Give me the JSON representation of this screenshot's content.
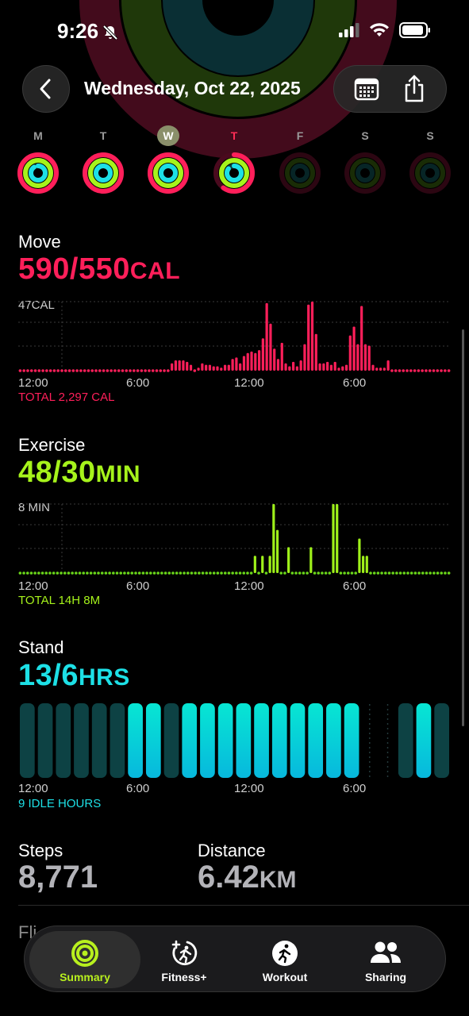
{
  "status_bar": {
    "time": "9:26"
  },
  "nav": {
    "title": "Wednesday, Oct 22, 2025"
  },
  "week": [
    {
      "letter": "M",
      "move": 1.0,
      "exercise": 1.0,
      "stand": 0.9,
      "state": "past"
    },
    {
      "letter": "T",
      "move": 1.0,
      "exercise": 1.0,
      "stand": 1.0,
      "state": "past"
    },
    {
      "letter": "W",
      "move": 1.0,
      "exercise": 1.0,
      "stand": 1.0,
      "state": "selected"
    },
    {
      "letter": "T",
      "move": 0.6,
      "exercise": 1.0,
      "stand": 0.85,
      "state": "today"
    },
    {
      "letter": "F",
      "move": 0,
      "exercise": 0,
      "stand": 0,
      "state": "future"
    },
    {
      "letter": "S",
      "move": 0,
      "exercise": 0,
      "stand": 0,
      "state": "future"
    },
    {
      "letter": "S",
      "move": 0,
      "exercise": 0,
      "stand": 0,
      "state": "future"
    }
  ],
  "move": {
    "title": "Move",
    "value": "590/550",
    "unit": "CAL",
    "scale_label": "47CAL",
    "total": "TOTAL 2,297 CAL",
    "ticks": [
      "12:00",
      "6:00",
      "12:00",
      "6:00"
    ],
    "color": "#ff1f5a"
  },
  "exercise": {
    "title": "Exercise",
    "value": "48/30",
    "unit": "MIN",
    "scale_label": "8 MIN",
    "total": "TOTAL 14H 8M",
    "ticks": [
      "12:00",
      "6:00",
      "12:00",
      "6:00"
    ],
    "color": "#a6f31b"
  },
  "stand": {
    "title": "Stand",
    "value": "13/6",
    "unit": "HRS",
    "total": "9 IDLE HOURS",
    "ticks": [
      "12:00",
      "6:00",
      "12:00",
      "6:00"
    ],
    "color": "#1de0e6"
  },
  "stats": {
    "steps_label": "Steps",
    "steps_value": "8,771",
    "distance_label": "Distance",
    "distance_value": "6.42",
    "distance_unit": "KM",
    "flights_label": "Fli"
  },
  "chart_data": [
    {
      "type": "bar",
      "title": "Move",
      "unit": "CAL",
      "x_label_ticks": [
        "12:00",
        "6:00",
        "12:00",
        "6:00"
      ],
      "ylim": [
        0,
        47
      ],
      "bins_per_hour": 4,
      "values": [
        1,
        1,
        1,
        1,
        1,
        1,
        1,
        1,
        1,
        1,
        1,
        1,
        1,
        1,
        1,
        1,
        1,
        1,
        1,
        1,
        1,
        1,
        1,
        1,
        1,
        1,
        1,
        1,
        1,
        1,
        1,
        1,
        1,
        1,
        1,
        1,
        1,
        1,
        1,
        1,
        5,
        7,
        7,
        7,
        6,
        4,
        1,
        2,
        5,
        4,
        4,
        3,
        3,
        2,
        4,
        4,
        8,
        9,
        5,
        10,
        12,
        13,
        12,
        14,
        22,
        46,
        32,
        15,
        8,
        19,
        5,
        3,
        6,
        3,
        7,
        18,
        45,
        47,
        25,
        5,
        5,
        6,
        4,
        6,
        2,
        3,
        4,
        24,
        30,
        18,
        44,
        18,
        17,
        4,
        2,
        2,
        2,
        7,
        1,
        1,
        1,
        1,
        1,
        1,
        1,
        1,
        1,
        1,
        1,
        1,
        1,
        1,
        1,
        1
      ]
    },
    {
      "type": "bar",
      "title": "Exercise",
      "unit": "MIN",
      "x_label_ticks": [
        "12:00",
        "6:00",
        "12:00",
        "6:00"
      ],
      "ylim": [
        0,
        8
      ],
      "bins_per_hour": 4,
      "values": [
        0,
        0,
        0,
        0,
        0,
        0,
        0,
        0,
        0,
        0,
        0,
        0,
        0,
        0,
        0,
        0,
        0,
        0,
        0,
        0,
        0,
        0,
        0,
        0,
        0,
        0,
        0,
        0,
        0,
        0,
        0,
        0,
        0,
        0,
        0,
        0,
        0,
        0,
        0,
        0,
        0,
        0,
        0,
        0,
        0,
        0,
        0,
        0,
        0,
        0,
        0,
        0,
        0,
        0,
        0,
        0,
        0,
        0,
        0,
        0,
        0,
        0,
        0,
        2,
        0,
        2,
        1,
        2,
        8,
        5,
        0,
        0,
        3,
        1,
        0,
        0,
        0,
        0,
        3,
        0,
        0,
        0,
        0,
        0,
        8,
        8,
        0,
        0,
        0,
        0,
        0,
        4,
        2,
        2,
        0,
        0,
        0,
        0,
        0,
        0,
        0,
        0,
        0,
        0,
        0,
        0,
        0,
        0,
        0,
        0,
        0,
        0,
        0,
        0,
        0,
        0
      ]
    },
    {
      "type": "bar",
      "title": "Stand",
      "unit": "HRS",
      "x_label_ticks": [
        "12:00",
        "6:00",
        "12:00",
        "6:00"
      ],
      "hours": [
        0,
        0,
        0,
        0,
        0,
        0,
        1,
        1,
        0,
        1,
        1,
        1,
        1,
        1,
        1,
        1,
        1,
        1,
        1,
        null,
        -1,
        0,
        1,
        0
      ]
    }
  ]
}
